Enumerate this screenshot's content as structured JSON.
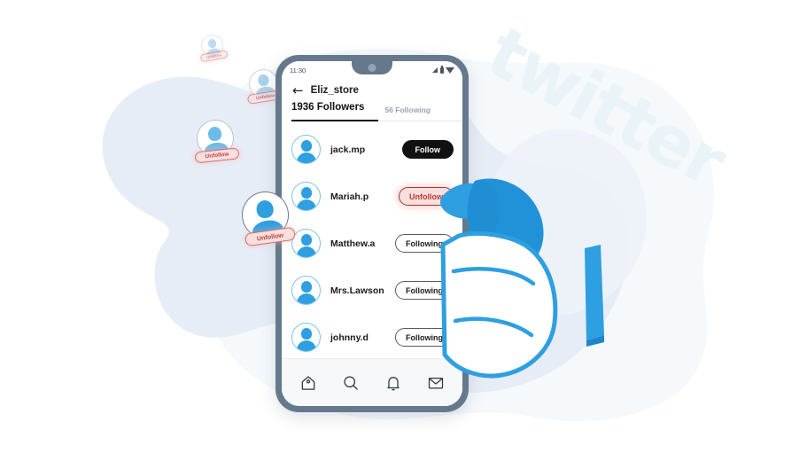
{
  "brand": {
    "watermark": "twitter",
    "accent_blue": "#2e9fe0",
    "frame_gray": "#66798c",
    "blob_blue": "#e7edf7",
    "blob_pale": "#f4f8fb",
    "unfollow_red": "#c0392b",
    "unfollow_bg": "#f9dede"
  },
  "phone": {
    "status": {
      "time": "11:30",
      "icons": [
        "signal-icon",
        "battery-icon",
        "wifi-icon"
      ]
    },
    "header": {
      "back_icon": "←",
      "title": "Eliz_store"
    },
    "tabs": [
      {
        "label": "1936 Followers",
        "active": true
      },
      {
        "label": "56 Following",
        "active": false
      }
    ],
    "users": [
      {
        "name": "jack.mp",
        "action": "Follow",
        "state": "follow"
      },
      {
        "name": "Mariah.p",
        "action": "Unfollow",
        "state": "unfollow"
      },
      {
        "name": "Matthew.a",
        "action": "Following",
        "state": "following"
      },
      {
        "name": "Mrs.Lawson",
        "action": "Following",
        "state": "following"
      },
      {
        "name": "johnny.d",
        "action": "Following",
        "state": "following"
      }
    ],
    "bottom_nav": [
      {
        "icon": "home-icon"
      },
      {
        "icon": "search-icon"
      },
      {
        "icon": "bell-icon"
      },
      {
        "icon": "envelope-icon"
      }
    ]
  },
  "floating_cards": [
    {
      "label": "Unfollow",
      "size": "xs"
    },
    {
      "label": "Unfollow",
      "size": "sm"
    },
    {
      "label": "Unfollow",
      "size": "md"
    },
    {
      "label": "Unfollow",
      "size": "lg"
    }
  ]
}
